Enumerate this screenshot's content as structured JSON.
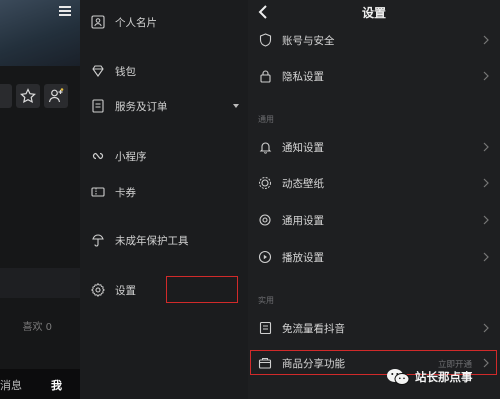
{
  "left_panel": {
    "count_text": "喜欢 0",
    "bottom_nav": {
      "messages": "消息",
      "me": "我"
    }
  },
  "drawer": {
    "items": [
      {
        "label": "个人名片",
        "icon": "contact-card-icon"
      },
      {
        "label": "钱包",
        "icon": "wallet-diamond-icon"
      },
      {
        "label": "服务及订单",
        "icon": "order-list-icon"
      },
      {
        "label": "小程序",
        "icon": "mini-program-icon"
      },
      {
        "label": "卡券",
        "icon": "coupon-icon"
      },
      {
        "label": "未成年保护工具",
        "icon": "minor-protection-icon"
      },
      {
        "label": "设置",
        "icon": "gear-icon"
      }
    ]
  },
  "settings": {
    "title": "设置",
    "sections": [
      {
        "label": "",
        "items": [
          {
            "label": "账号与安全",
            "icon": "shield-icon"
          },
          {
            "label": "隐私设置",
            "icon": "lock-icon"
          }
        ]
      },
      {
        "label": "通用",
        "items": [
          {
            "label": "通知设置",
            "icon": "bell-icon"
          },
          {
            "label": "动态壁纸",
            "icon": "wallpaper-icon"
          },
          {
            "label": "通用设置",
            "icon": "settings-icon"
          },
          {
            "label": "播放设置",
            "icon": "play-icon"
          }
        ]
      },
      {
        "label": "实用",
        "items": [
          {
            "label": "免流量看抖音",
            "icon": "data-free-icon"
          },
          {
            "label": "商品分享功能",
            "icon": "shop-share-icon",
            "sub": "立即开通"
          }
        ]
      }
    ]
  },
  "watermark": {
    "text": "站长那点事"
  },
  "colors": {
    "highlight": "#d12a2a",
    "panel": "#1e1f21",
    "drawer": "#1b1c1e"
  }
}
